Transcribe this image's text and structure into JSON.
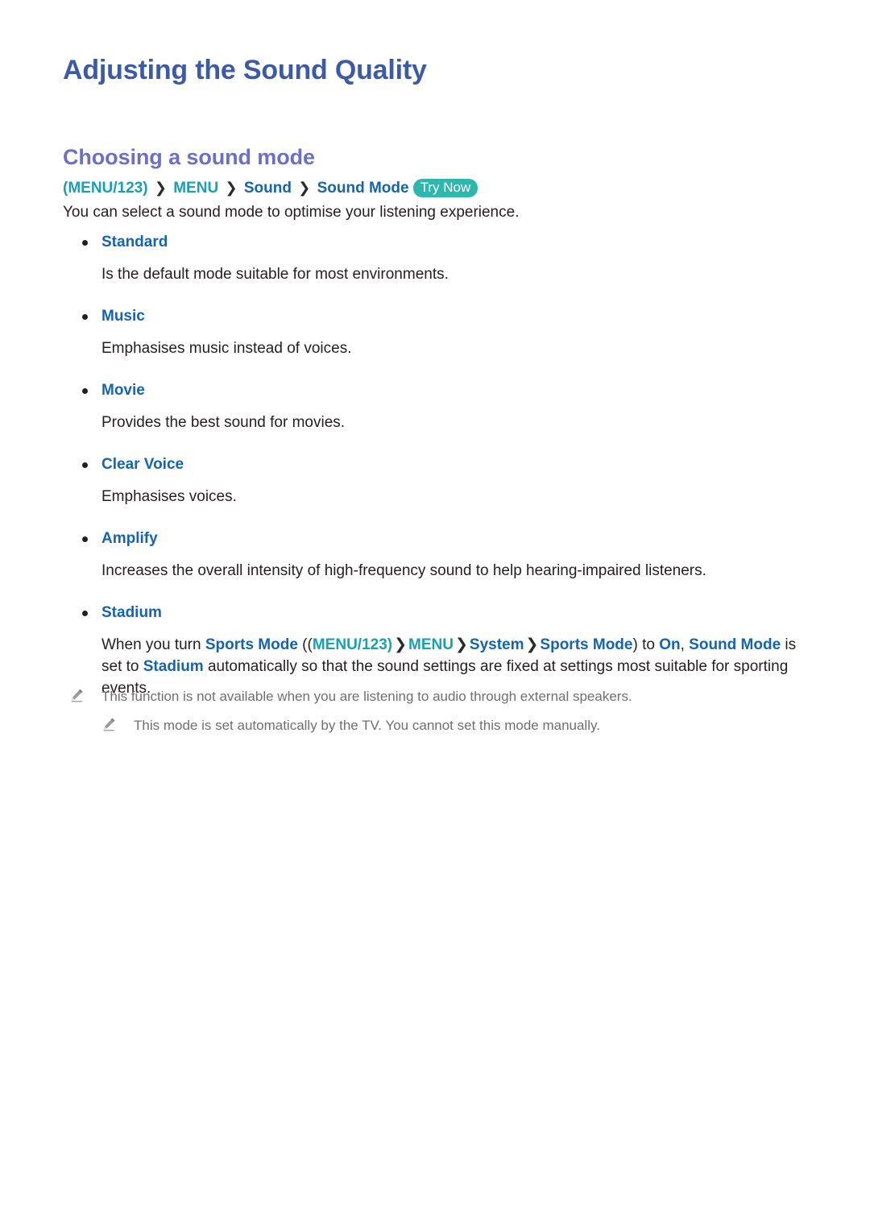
{
  "document": {
    "title": "Adjusting the Sound Quality",
    "section_title": "Choosing a sound mode",
    "intro": "You can select a sound mode to optimise your listening experience."
  },
  "colors": {
    "h1": "#3c5ba4",
    "h2": "#6c6fc6",
    "link_blue": "#1464ae",
    "link_teal": "#18a0b4",
    "badge_teal": "#2fb6ae",
    "body_text": "#231f20",
    "note_text": "#6f6f72"
  },
  "breadcrumb": {
    "open_paren": "(",
    "menu123": "MENU/123",
    "close_paren": ")",
    "arrow": "❯",
    "menu": "MENU",
    "sound": "Sound",
    "sound_mode": "Sound Mode",
    "try_now": "Try Now"
  },
  "sound_modes": [
    {
      "name": "Standard",
      "description": "Is the default mode suitable for most environments."
    },
    {
      "name": "Music",
      "description": "Emphasises music instead of voices."
    },
    {
      "name": "Movie",
      "description": "Provides the best sound for movies."
    },
    {
      "name": "Clear Voice",
      "description": "Emphasises voices."
    },
    {
      "name": "Amplify",
      "description": "Increases the overall intensity of high-frequency sound to help hearing-impaired listeners."
    },
    {
      "name": "Stadium",
      "description": ""
    }
  ],
  "stadium_paragraph": {
    "part1": "When you turn ",
    "sports_mode_1": "Sports Mode",
    "part2": " ((",
    "menu123": "MENU/123",
    "part3": ")",
    "arrow": "❯",
    "menu": "MENU",
    "system": "System",
    "sports_mode_2": "Sports Mode",
    "part4": ") to ",
    "on": "On",
    "part5": ", ",
    "sound_mode": "Sound Mode",
    "part6": " is set to ",
    "stadium": "Stadium",
    "part7": " automatically so that the sound settings are fixed at settings most suitable for sporting events."
  },
  "notes": [
    {
      "icon": "pencil-icon",
      "text": "This mode is set automatically by the TV. You cannot set this mode manually."
    },
    {
      "icon": "pencil-icon",
      "text": "This function is not available when you are listening to audio through external speakers."
    }
  ]
}
